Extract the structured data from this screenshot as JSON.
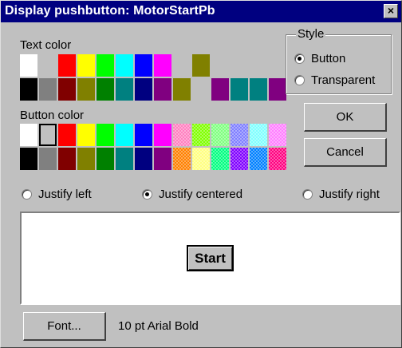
{
  "window": {
    "title": "Display pushbutton: MotorStartPb",
    "close_glyph": "×"
  },
  "text_color": {
    "label": "Text color",
    "row1": [
      "#ffffff",
      "#c0c0c0",
      "#ff0000",
      "#ffff00",
      "#00ff00",
      "#00ffff",
      "#0000ff",
      "#ff00ff",
      "#c0c0c0",
      "#808000",
      "#c0c0c0",
      "#c0c0c0",
      "#c0c0c0",
      "#c0c0c0"
    ],
    "row2": [
      "#000000",
      "#808080",
      "#800000",
      "#808000",
      "#008000",
      "#008080",
      "#000080",
      "#800080",
      "#808000",
      "#c0c0c0",
      "#800080",
      "#008080",
      "#008080",
      "#800080"
    ]
  },
  "button_color": {
    "label": "Button color",
    "row1": [
      "#ffffff",
      "#c0c0c0",
      "#ff0000",
      "#ffff00",
      "#00ff00",
      "#00ffff",
      "#0000ff",
      "#ff00ff",
      "#ff80c0",
      "#80ff00",
      "#80ff80",
      "#8080ff",
      "#80ffff",
      "#ff80ff"
    ],
    "row2": [
      "#000000",
      "#808080",
      "#800000",
      "#808000",
      "#008000",
      "#008080",
      "#000080",
      "#800080",
      "#ff8000",
      "#ffff80",
      "#00ff80",
      "#8000ff",
      "#0080ff",
      "#ff0080"
    ],
    "selected_row": 0,
    "selected_index": 1
  },
  "style_group": {
    "label": "Style",
    "options": [
      {
        "label": "Button",
        "checked": true
      },
      {
        "label": "Transparent",
        "checked": false
      }
    ]
  },
  "buttons": {
    "ok": "OK",
    "cancel": "Cancel",
    "font": "Font..."
  },
  "justify": {
    "left": "Justify left",
    "centered": "Justify centered",
    "right": "Justify right",
    "selected": "centered"
  },
  "preview": {
    "button_label": "Start"
  },
  "font_description": "10 pt Arial Bold"
}
